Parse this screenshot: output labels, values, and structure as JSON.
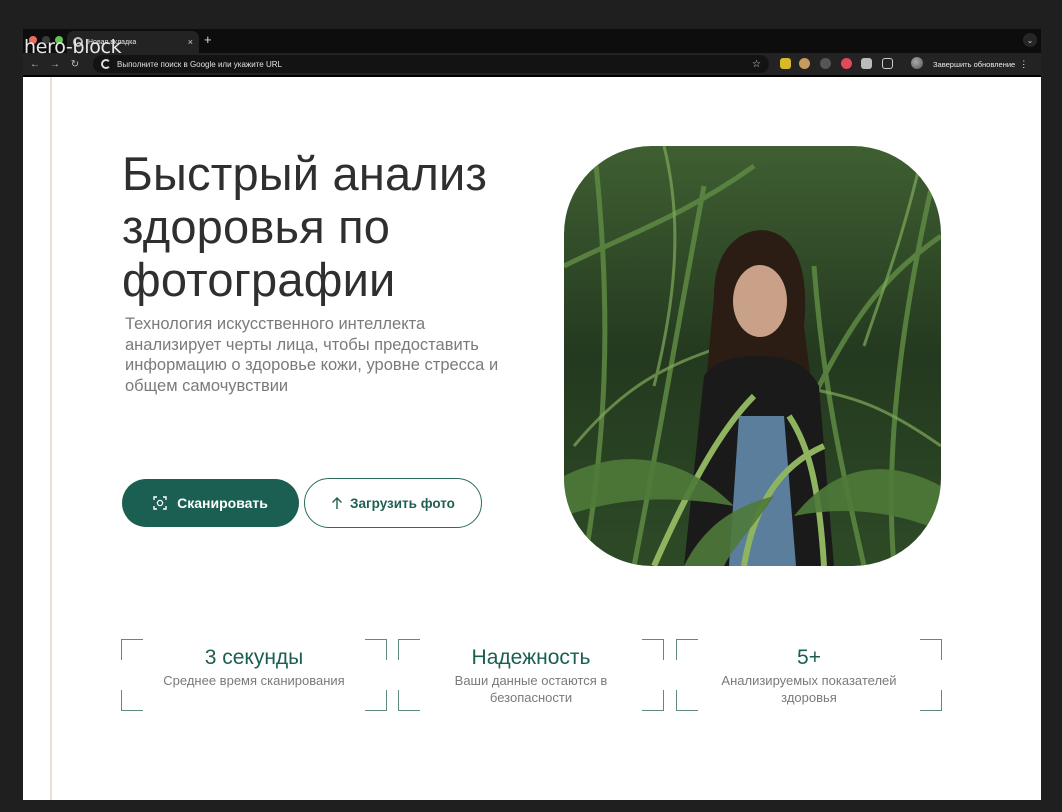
{
  "overlay_label": "hero-block",
  "browser": {
    "tab_title": "Новая вкладка",
    "tab_close": "×",
    "new_tab": "+",
    "address_placeholder": "Выполните поиск в Google или укажите URL",
    "update_label": "Завершить обновление"
  },
  "hero": {
    "title": "Быстрый анализ здоровья по фотографии",
    "subtitle": "Технология искусственного интеллекта анализирует черты лица, чтобы предоставить информацию о здоровье кожи, уровне стресса и общем самочувствии",
    "scan_button": "Сканировать",
    "upload_button": "Загрузить фото"
  },
  "stats": [
    {
      "value": "3 секунды",
      "caption": "Среднее время сканирования"
    },
    {
      "value": "Надежность",
      "caption": "Ваши данные остаются в безопасности"
    },
    {
      "value": "5+",
      "caption": "Анализируемых показателей здоровья"
    }
  ],
  "colors": {
    "accent": "#1a5f52",
    "text_dark": "#2f2f2f",
    "text_muted": "#7a7a7a"
  },
  "icons": {
    "scan": "scan-frame-icon",
    "upload": "arrow-up-icon"
  }
}
